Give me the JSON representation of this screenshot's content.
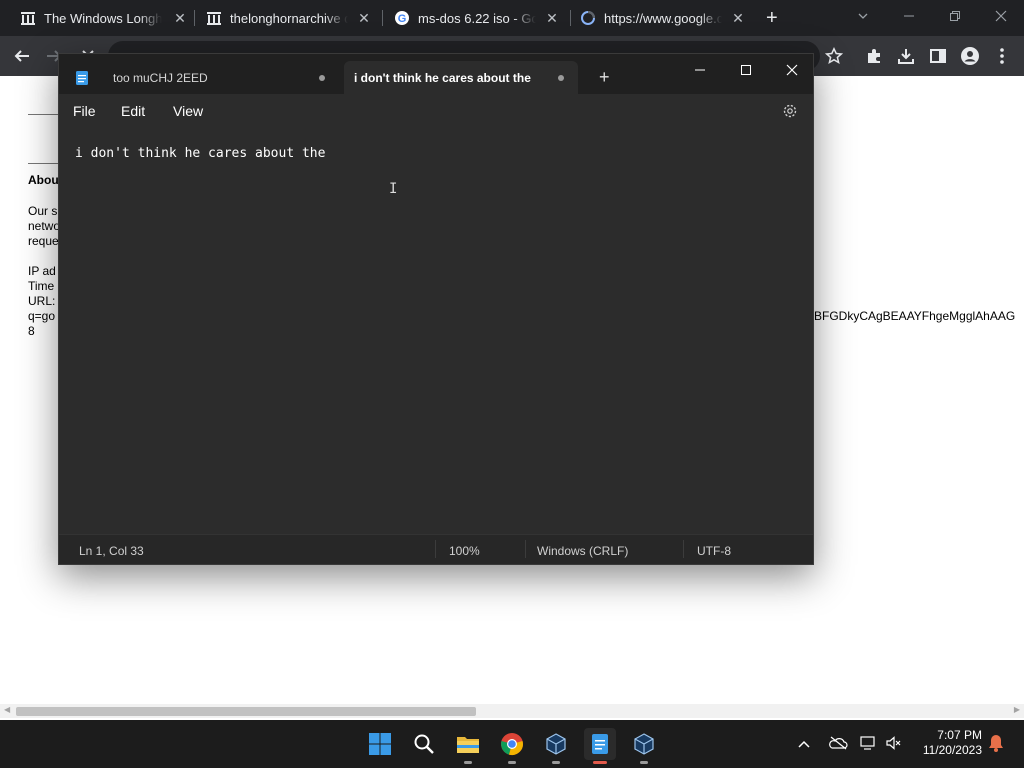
{
  "chrome": {
    "tabs": [
      {
        "title": "The Windows Longhor",
        "favicon": "archive-icon"
      },
      {
        "title": "thelonghornarchive d",
        "favicon": "archive-icon"
      },
      {
        "title": "ms-dos 6.22 iso - Goo",
        "favicon": "google-g-icon"
      },
      {
        "title": "https://www.google.c",
        "favicon": "loading-globe-icon"
      }
    ],
    "new_tab_symbol": "+",
    "close_symbol": "✕"
  },
  "page": {
    "heading": "Abou",
    "lines": [
      "Our s",
      "netwo",
      "reque"
    ],
    "info_lines": [
      "IP ad",
      "Time",
      "URL:",
      "q=go",
      "8"
    ],
    "right_text": "BFGDkyCAgBEAAYFhgeMgglAhAAG"
  },
  "notepad": {
    "tabs": [
      {
        "title": "too muCHJ 2EED"
      },
      {
        "title": "i don't think he cares about the"
      }
    ],
    "menu": {
      "file": "File",
      "edit": "Edit",
      "view": "View"
    },
    "content": "i don't think he cares about the",
    "status": {
      "position": "Ln 1, Col 33",
      "zoom": "100%",
      "line_ending": "Windows (CRLF)",
      "encoding": "UTF-8"
    }
  },
  "taskbar": {
    "time": "7:07 PM",
    "date": "11/20/2023"
  },
  "colors": {
    "chrome_dark": "#202124",
    "chrome_toolbar": "#35363a",
    "notepad_bg": "#2c2c2c",
    "taskbar_bg": "#1c1c1c",
    "windows_blue": "#3a9be8",
    "notification_orange": "#e8704a"
  }
}
